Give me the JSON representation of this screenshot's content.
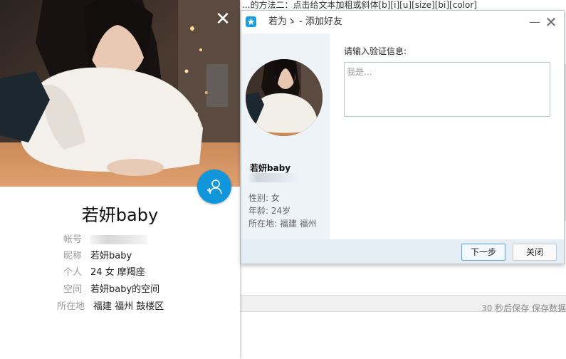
{
  "background": {
    "top_text": "...的方法二：点击给文本加粗或斜体[b][i][u][size][bi][color]",
    "status_text": "30 秒后保存 保存数据"
  },
  "profile": {
    "close_glyph": "✕",
    "name": "若妍baby",
    "rows": [
      {
        "label": "帐号",
        "value": ""
      },
      {
        "label": "昵称",
        "value": "若妍baby"
      },
      {
        "label": "个人",
        "value": "24  女  摩羯座"
      },
      {
        "label": "空间",
        "value": "若妍baby的空间"
      },
      {
        "label": "所在地",
        "value": "福建  福州  鼓楼区"
      }
    ],
    "fab_icon": "add-contact-icon"
  },
  "dialog": {
    "title": "若为ゝ - 添加好友",
    "minimize_glyph": "—",
    "close_glyph": "✕",
    "nick": "若妍baby",
    "gender": "性别: 女",
    "age": "年龄: 24岁",
    "location": "所在地: 福建   福州",
    "verify_label": "请输入验证信息:",
    "verify_placeholder": "我是...",
    "next_label": "下一步",
    "close_label": "关闭"
  },
  "colors": {
    "accent": "#1296db",
    "dialog_footer": "#e5edf5",
    "dialog_sidebar": "#eef3f8"
  }
}
